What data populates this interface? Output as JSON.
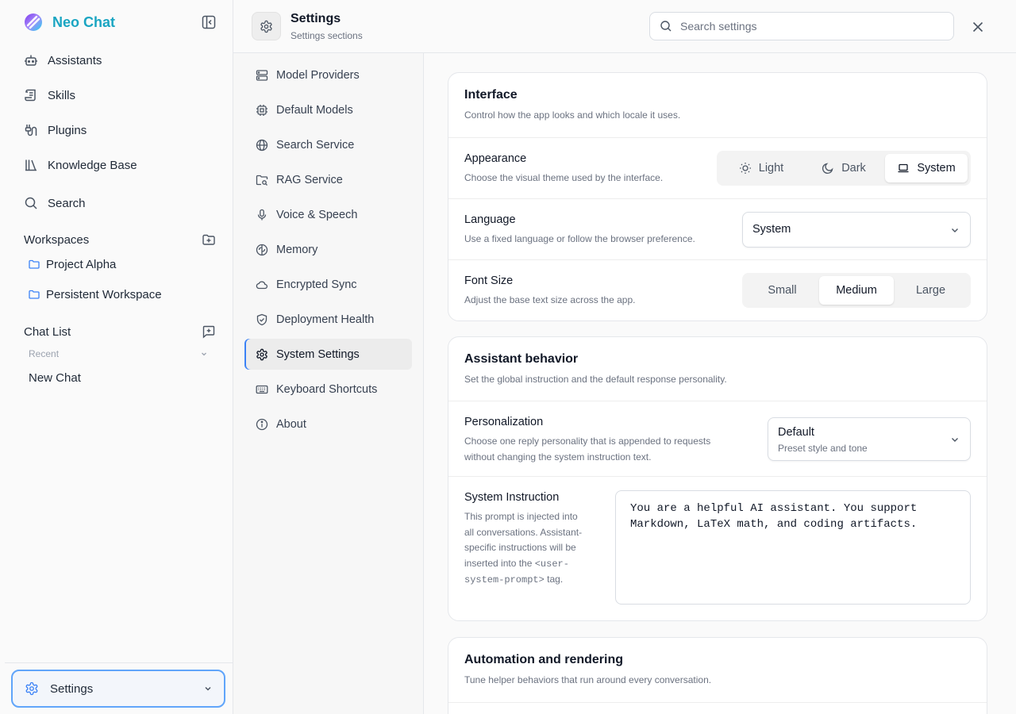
{
  "app": {
    "name": "Neo Chat"
  },
  "sidebar": {
    "nav": [
      {
        "label": "Assistants",
        "icon": "bot-icon"
      },
      {
        "label": "Skills",
        "icon": "scroll-icon"
      },
      {
        "label": "Plugins",
        "icon": "plug-icon"
      },
      {
        "label": "Knowledge Base",
        "icon": "library-icon"
      },
      {
        "label": "Search",
        "icon": "search-icon"
      }
    ],
    "workspaces_title": "Workspaces",
    "workspaces": [
      "Project Alpha",
      "Persistent Workspace"
    ],
    "chat_list_title": "Chat List",
    "recent_label": "Recent",
    "chats": [
      "New Chat"
    ],
    "settings_label": "Settings"
  },
  "header": {
    "title": "Settings",
    "subtitle": "Settings sections",
    "search_placeholder": "Search settings"
  },
  "menu": {
    "items": [
      {
        "label": "Model Providers",
        "icon": "server-icon"
      },
      {
        "label": "Default Models",
        "icon": "cpu-icon"
      },
      {
        "label": "Search Service",
        "icon": "globe-icon"
      },
      {
        "label": "RAG Service",
        "icon": "folder-search-icon"
      },
      {
        "label": "Voice & Speech",
        "icon": "mic-icon"
      },
      {
        "label": "Memory",
        "icon": "brain-icon"
      },
      {
        "label": "Encrypted Sync",
        "icon": "cloud-icon"
      },
      {
        "label": "Deployment Health",
        "icon": "shield-check-icon"
      },
      {
        "label": "System Settings",
        "icon": "gear-icon"
      },
      {
        "label": "Keyboard Shortcuts",
        "icon": "keyboard-icon"
      },
      {
        "label": "About",
        "icon": "info-icon"
      }
    ],
    "active": "System Settings"
  },
  "interface": {
    "title": "Interface",
    "description": "Control how the app looks and which locale it uses.",
    "appearance": {
      "label": "Appearance",
      "description": "Choose the visual theme used by the interface.",
      "options": [
        "Light",
        "Dark",
        "System"
      ],
      "selected": "System"
    },
    "language": {
      "label": "Language",
      "description": "Use a fixed language or follow the browser preference.",
      "value": "System"
    },
    "font_size": {
      "label": "Font Size",
      "description": "Adjust the base text size across the app.",
      "options": [
        "Small",
        "Medium",
        "Large"
      ],
      "selected": "Medium"
    }
  },
  "assistant": {
    "title": "Assistant behavior",
    "description": "Set the global instruction and the default response personality.",
    "personalization": {
      "label": "Personalization",
      "description_line1": "Choose one reply personality that is appended to requests",
      "description_line2": "without changing the system instruction text.",
      "value": "Default",
      "value_sub": "Preset style and tone"
    },
    "system_instruction": {
      "label": "System Instruction",
      "desc_line1": "This prompt is injected into",
      "desc_line2": "all conversations. Assistant-",
      "desc_line3": "specific instructions will be",
      "desc_line4_a": "inserted into the",
      "desc_tag1": "<user-",
      "desc_tag2": "system-prompt>",
      "desc_line5_b": "tag.",
      "value": "You are a helpful AI assistant. You support\nMarkdown, LaTeX math, and coding artifacts."
    }
  },
  "automation": {
    "title": "Automation and rendering",
    "description": "Tune helper behaviors that run around every conversation."
  },
  "colors": {
    "brand": "#1aa5c2",
    "accent": "#3b82f6"
  }
}
